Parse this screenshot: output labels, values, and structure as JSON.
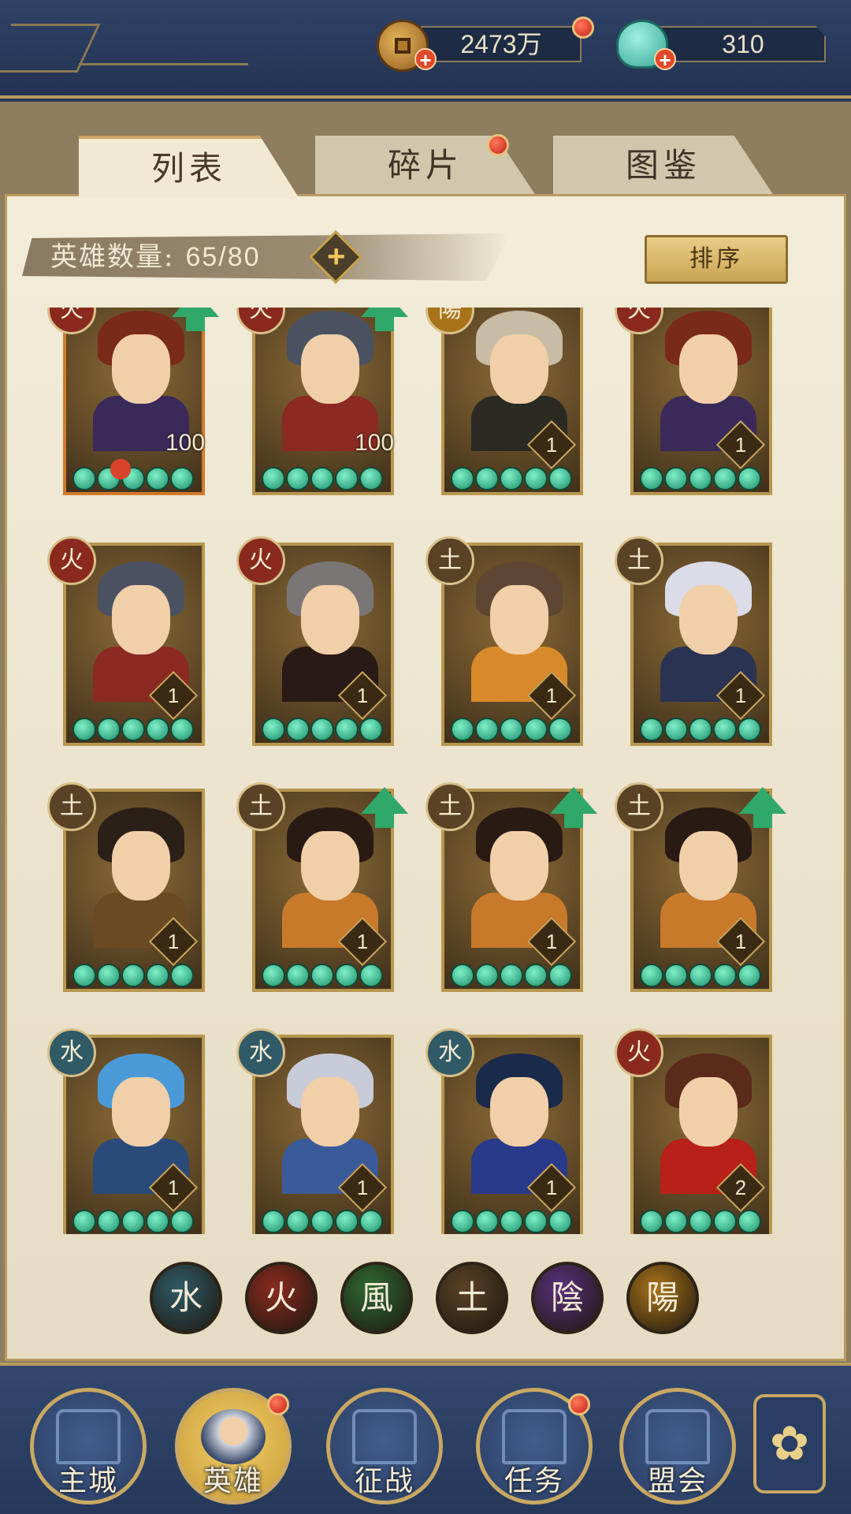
{
  "resources": {
    "gold": {
      "value": "2473万",
      "icon": "copper-coin-icon"
    },
    "gems": {
      "value": "310",
      "icon": "jade-shell-icon"
    }
  },
  "tabs": [
    {
      "label": "列表",
      "active": true
    },
    {
      "label": "碎片",
      "active": false,
      "badge": true
    },
    {
      "label": "图鉴",
      "active": false
    }
  ],
  "hero_count": {
    "label": "英雄数量:",
    "value": "65/80"
  },
  "sort_label": "排序",
  "heroes": [
    {
      "element": "火",
      "level": "100",
      "upgrade": true,
      "hair": "#7a2a18",
      "body": "#3a2a5a"
    },
    {
      "element": "火",
      "level": "100",
      "upgrade": true,
      "hair": "#4a5262",
      "body": "#8a2a22"
    },
    {
      "element": "陽",
      "level": "1",
      "upgrade": false,
      "hair": "#c8bca4",
      "body": "#2a2a22"
    },
    {
      "element": "火",
      "level": "1",
      "upgrade": false,
      "hair": "#7a2a18",
      "body": "#3a2a5a"
    },
    {
      "element": "火",
      "level": "1",
      "upgrade": false,
      "hair": "#4a5262",
      "body": "#8a2a22"
    },
    {
      "element": "火",
      "level": "1",
      "upgrade": false,
      "hair": "#7a7676",
      "body": "#2a1a16"
    },
    {
      "element": "土",
      "level": "1",
      "upgrade": false,
      "hair": "#5e4632",
      "body": "#d88a2a"
    },
    {
      "element": "土",
      "level": "1",
      "upgrade": false,
      "hair": "#dcdce8",
      "body": "#2a3452"
    },
    {
      "element": "土",
      "level": "1",
      "upgrade": false,
      "hair": "#2a2018",
      "body": "#6a4a22"
    },
    {
      "element": "土",
      "level": "1",
      "upgrade": true,
      "hair": "#2a1a14",
      "body": "#c87a2a"
    },
    {
      "element": "土",
      "level": "1",
      "upgrade": true,
      "hair": "#2a1a14",
      "body": "#c87a2a"
    },
    {
      "element": "土",
      "level": "1",
      "upgrade": true,
      "hair": "#2a1a14",
      "body": "#c87a2a"
    },
    {
      "element": "水",
      "level": "1",
      "upgrade": false,
      "hair": "#4a9ad8",
      "body": "#2a4a7a"
    },
    {
      "element": "水",
      "level": "1",
      "upgrade": false,
      "hair": "#c8ccd8",
      "body": "#3a5a9a"
    },
    {
      "element": "水",
      "level": "1",
      "upgrade": false,
      "hair": "#1a2a4a",
      "body": "#2a3a8a"
    },
    {
      "element": "火",
      "level": "2",
      "upgrade": false,
      "hair": "#5a2a1a",
      "body": "#b8201a"
    }
  ],
  "filters": [
    {
      "glyph": "水",
      "color": "#2f5a66",
      "name": "water"
    },
    {
      "glyph": "火",
      "color": "#8a2a1e",
      "name": "fire"
    },
    {
      "glyph": "風",
      "color": "#2f6a32",
      "name": "wind"
    },
    {
      "glyph": "土",
      "color": "#5a4226",
      "name": "earth"
    },
    {
      "glyph": "陰",
      "color": "#5a2f7a",
      "name": "yin"
    },
    {
      "glyph": "陽",
      "color": "#a8731a",
      "name": "yang"
    }
  ],
  "nav": [
    {
      "label": "主城",
      "icon": "city-gate-icon",
      "active": false,
      "badge": false
    },
    {
      "label": "英雄",
      "icon": "hero-portrait-icon",
      "active": true,
      "badge": true
    },
    {
      "label": "征战",
      "icon": "war-horn-icon",
      "active": false,
      "badge": false
    },
    {
      "label": "任务",
      "icon": "scroll-task-icon",
      "active": false,
      "badge": true
    },
    {
      "label": "盟会",
      "icon": "alliance-gate-icon",
      "active": false,
      "badge": false
    }
  ],
  "menu_icon": "flower-menu-icon"
}
